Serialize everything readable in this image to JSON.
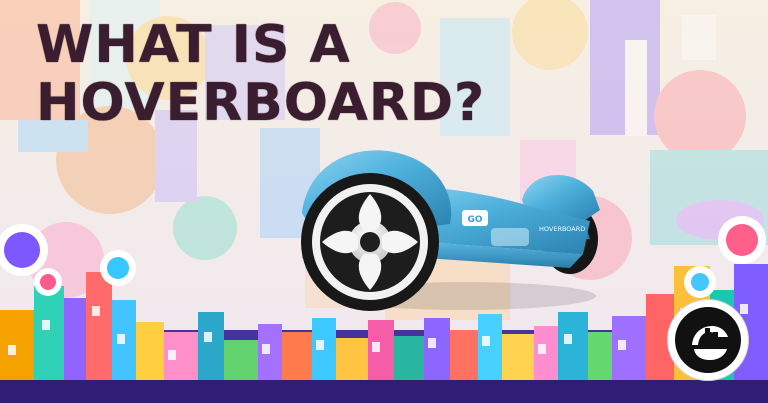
{
  "heading": {
    "line1": "WHAT IS A",
    "line2": "HOVERBOARD?"
  },
  "product": {
    "brand_badge": "GO",
    "side_text": "HOVERBOARD"
  },
  "logo": {
    "icon": "brand-logo-icon"
  },
  "colors": {
    "heading": "#3a1d2f",
    "board": "#4fb0d8",
    "board_dark": "#2f86b0",
    "wheel_dark": "#1b1b1b",
    "wheel_light": "#ffffff"
  }
}
